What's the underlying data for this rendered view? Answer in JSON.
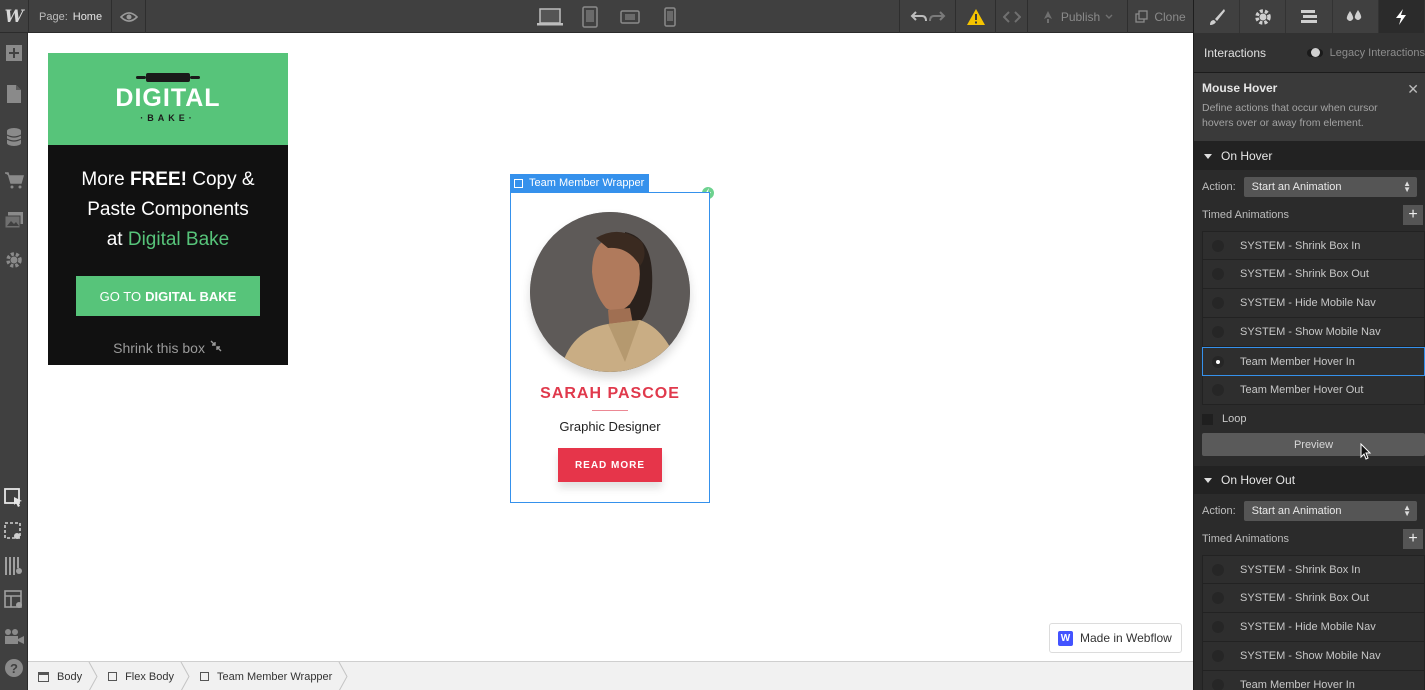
{
  "app": {
    "logo": "W",
    "page_label": "Page:",
    "page_name": "Home",
    "publish_label": "Publish",
    "clone_label": "Clone"
  },
  "promo": {
    "brand": "DIGITAL",
    "brand_sub": "·BAKE·",
    "line1a": "More ",
    "line1b": "FREE!",
    "line1c": " Copy &",
    "line2": "Paste Components",
    "line3a": "at ",
    "line3b": "Digital Bake",
    "cta_a": "GO TO",
    "cta_b": "DIGITAL BAKE",
    "shrink": "Shrink this box"
  },
  "selection": {
    "label": "Team Member Wrapper"
  },
  "card": {
    "name": "SARAH PASCOE",
    "role": "Graphic Designer",
    "button": "READ MORE"
  },
  "badge": {
    "label": "Made in Webflow"
  },
  "breadcrumbs": [
    "Body",
    "Flex Body",
    "Team Member Wrapper"
  ],
  "panel": {
    "header": "Interactions",
    "legacy": "Legacy Interactions",
    "trigger_title": "Mouse Hover",
    "trigger_desc": "Define actions that occur when cursor hovers over or away from element.",
    "on_hover": {
      "title": "On Hover",
      "action_label": "Action:",
      "action_value": "Start an Animation",
      "timed_label": "Timed Animations",
      "animations": [
        "SYSTEM - Shrink Box In",
        "SYSTEM - Shrink Box Out",
        "SYSTEM - Hide Mobile Nav",
        "SYSTEM - Show Mobile Nav",
        "Team Member Hover In",
        "Team Member Hover Out"
      ],
      "selected": "Team Member Hover In",
      "loop_label": "Loop",
      "preview_label": "Preview"
    },
    "on_hover_out": {
      "title": "On Hover Out",
      "action_label": "Action:",
      "action_value": "Start an Animation",
      "timed_label": "Timed Animations",
      "animations": [
        "SYSTEM - Shrink Box In",
        "SYSTEM - Shrink Box Out",
        "SYSTEM - Hide Mobile Nav",
        "SYSTEM - Show Mobile Nav",
        "Team Member Hover In"
      ]
    }
  },
  "colors": {
    "selection_blue": "#3591ec",
    "brand_green": "#57c47a",
    "accent_red": "#e6354a",
    "warning_yellow": "#f5c400"
  }
}
